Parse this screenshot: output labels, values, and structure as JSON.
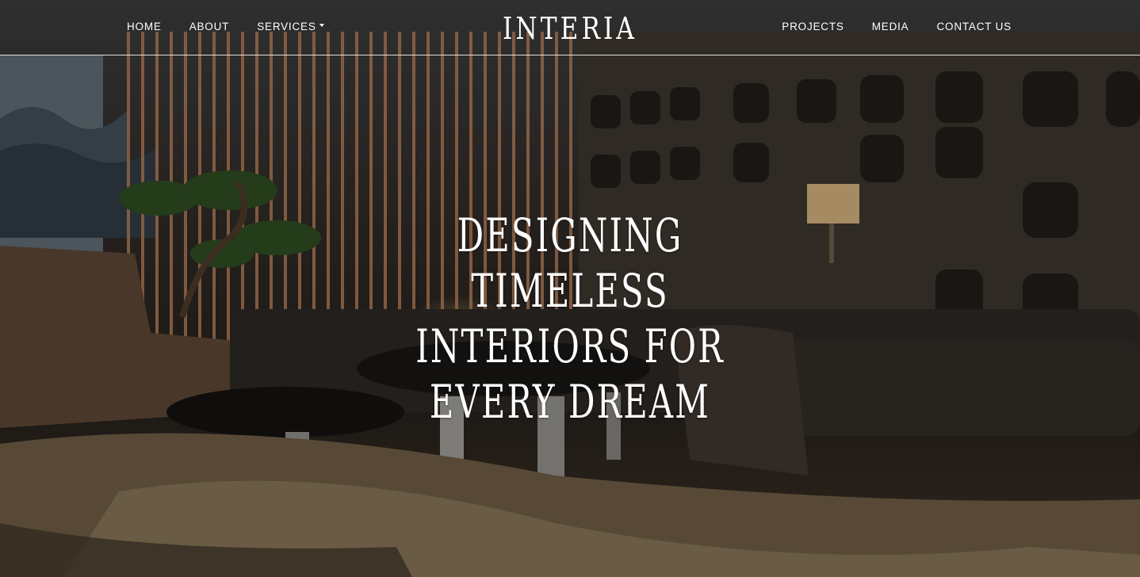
{
  "header": {
    "logo": "INTERIA",
    "nav_left": [
      {
        "label": "HOME"
      },
      {
        "label": "ABOUT"
      },
      {
        "label": "SERVICES",
        "has_dropdown": true
      }
    ],
    "nav_right": [
      {
        "label": "PROJECTS"
      },
      {
        "label": "MEDIA"
      },
      {
        "label": "CONTACT US"
      }
    ]
  },
  "hero": {
    "headline": "DESIGNING TIMELESS INTERIORS FOR EVERY DREAM",
    "background_image": "dark luxury living room with sofas, bonsai tree, round coffee tables and patterned rug"
  },
  "colors": {
    "text": "#ffffff",
    "divider": "#ffffff",
    "background_dark": "#241f1a"
  }
}
